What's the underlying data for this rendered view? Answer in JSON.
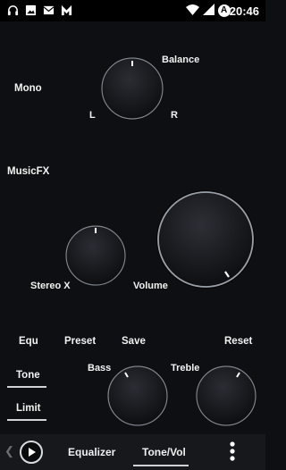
{
  "statusbar": {
    "time": "20:46",
    "battery_level": "A"
  },
  "mono": {
    "label": "Mono",
    "balance_label": "Balance",
    "left_label": "L",
    "right_label": "R"
  },
  "musicfx": {
    "label": "MusicFX",
    "stereo_label": "Stereo X",
    "volume_label": "Volume"
  },
  "eq": {
    "equ_label": "Equ",
    "preset_label": "Preset",
    "save_label": "Save",
    "reset_label": "Reset",
    "tone_label": "Tone",
    "limit_label": "Limit",
    "bass_label": "Bass",
    "treble_label": "Treble"
  },
  "bottom": {
    "equalizer_label": "Equalizer",
    "tonevol_label": "Tone/Vol",
    "back_glyph": "❮"
  },
  "colors": {
    "accent": "#ffffff",
    "background": "#0e0f12",
    "knob_ring": "#8a9098"
  }
}
